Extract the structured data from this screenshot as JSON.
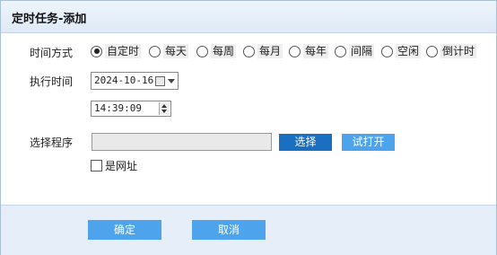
{
  "dialog": {
    "title": "定时任务-添加"
  },
  "schedule": {
    "label": "时间方式",
    "options": [
      "自定时",
      "每天",
      "每周",
      "每月",
      "每年",
      "间隔",
      "空闲",
      "倒计时"
    ],
    "selected": "自定时"
  },
  "exec_time": {
    "label": "执行时间",
    "date": "2024-10-16",
    "time": "14:39:09"
  },
  "program": {
    "label": "选择程序",
    "path": "",
    "select_label": "选择",
    "test_open_label": "试打开",
    "is_url_label": "是网址",
    "is_url_checked": false
  },
  "footer": {
    "ok_label": "确定",
    "cancel_label": "取消"
  }
}
